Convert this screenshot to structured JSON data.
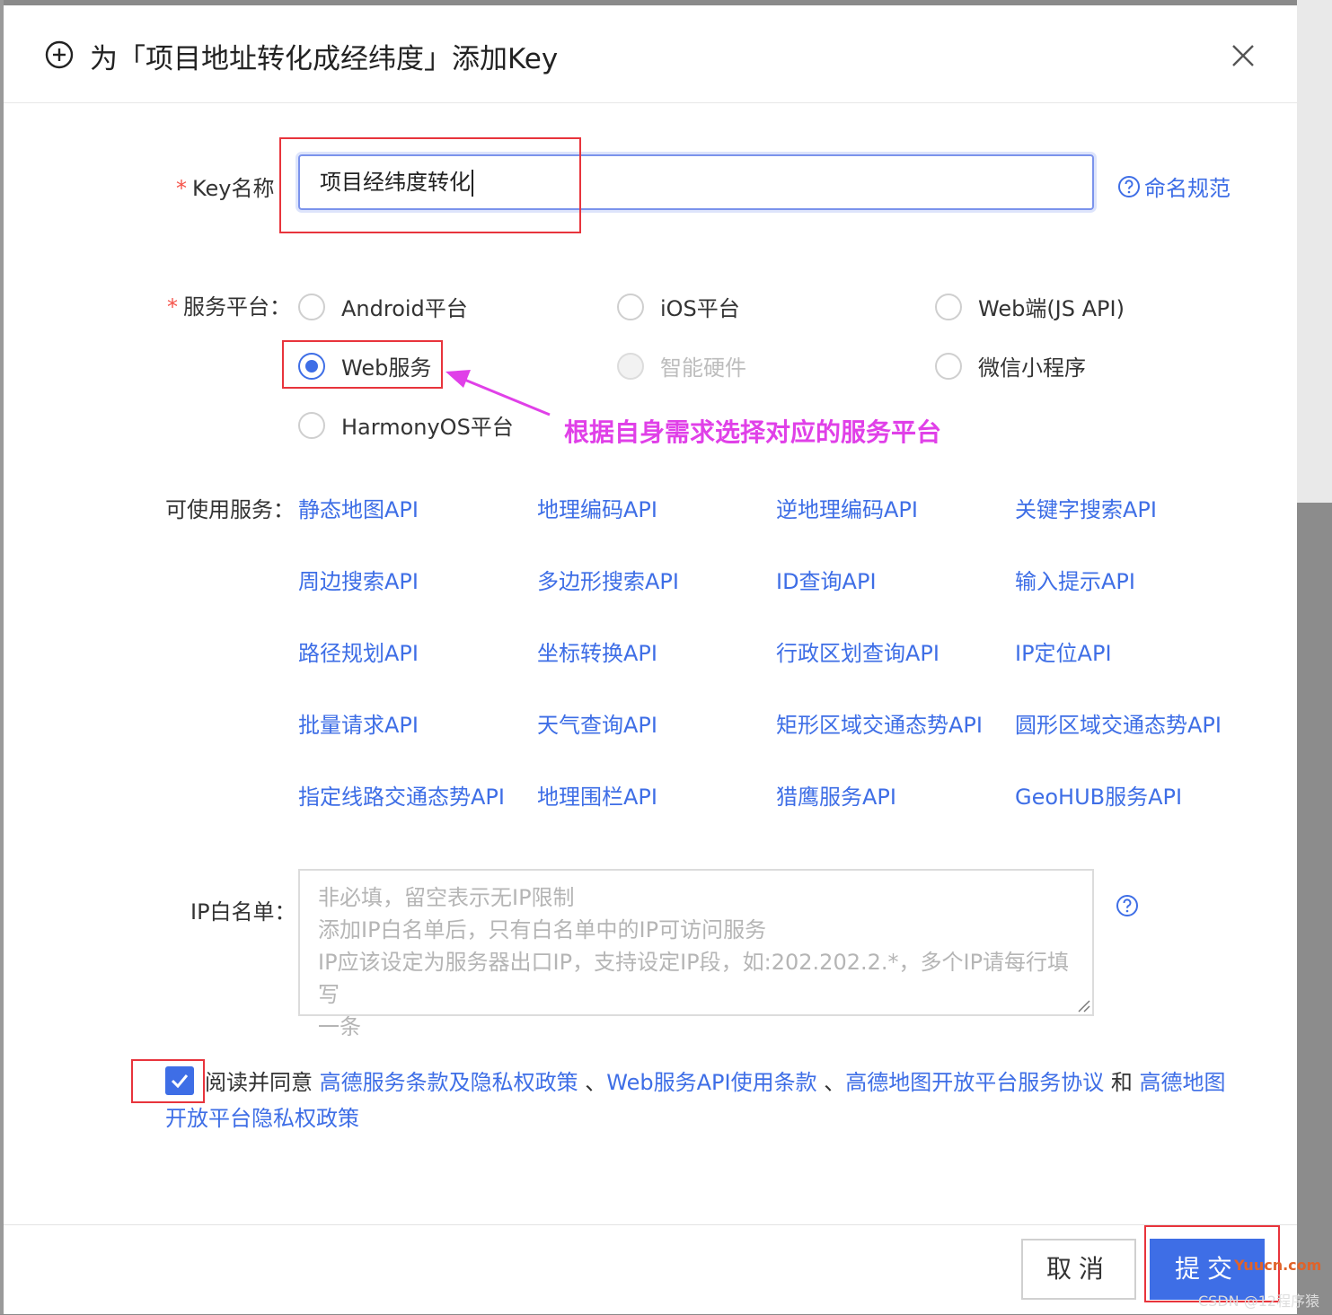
{
  "dialog": {
    "title": "为「项目地址转化成经纬度」添加Key",
    "close_icon": "close-icon"
  },
  "form": {
    "key_name_label": "Key名称",
    "key_name_value": "项目经纬度转化",
    "naming_rule_link": "命名规范",
    "platform_label": "服务平台：",
    "platforms": [
      {
        "label": "Android平台",
        "selected": false,
        "disabled": false
      },
      {
        "label": "iOS平台",
        "selected": false,
        "disabled": false
      },
      {
        "label": "Web端(JS API)",
        "selected": false,
        "disabled": false
      },
      {
        "label": "Web服务",
        "selected": true,
        "disabled": false
      },
      {
        "label": "智能硬件",
        "selected": false,
        "disabled": true
      },
      {
        "label": "微信小程序",
        "selected": false,
        "disabled": false
      },
      {
        "label": "HarmonyOS平台",
        "selected": false,
        "disabled": false
      }
    ],
    "services_label": "可使用服务：",
    "services": [
      "静态地图API",
      "地理编码API",
      "逆地理编码API",
      "关键字搜索API",
      "周边搜索API",
      "多边形搜索API",
      "ID查询API",
      "输入提示API",
      "路径规划API",
      "坐标转换API",
      "行政区划查询API",
      "IP定位API",
      "批量请求API",
      "天气查询API",
      "矩形区域交通态势API",
      "圆形区域交通态势API",
      "指定线路交通态势API",
      "地理围栏API",
      "猎鹰服务API",
      "GeoHUB服务API"
    ],
    "ip_label": "IP白名单：",
    "ip_placeholder_lines": [
      "非必填，留空表示无IP限制",
      "添加IP白名单后，只有白名单中的IP可访问服务",
      "IP应该设定为服务器出口IP，支持设定IP段，如:202.202.2.*，多个IP请每行填写",
      "一条"
    ]
  },
  "agreement": {
    "checked": true,
    "prefix": "阅读并同意 ",
    "link1": "高德服务条款及隐私权政策",
    "sep1": " 、",
    "link2": "Web服务API使用条款",
    "sep2": " 、",
    "link3": "高德地图开放平台服务协议",
    "sep3": " 和 ",
    "link4": "高德地图开放平台隐私权政策"
  },
  "footer": {
    "cancel_label": "取消",
    "submit_label": "提交"
  },
  "annotation": {
    "text": "根据自身需求选择对应的服务平台",
    "color": "#e040e8"
  },
  "watermark": {
    "site": "Yuucn.com",
    "author": "CSDN @12程序猿"
  },
  "colors": {
    "accent": "#3e6ee6",
    "required": "#f5544b",
    "annotation_box": "#e8343c"
  }
}
